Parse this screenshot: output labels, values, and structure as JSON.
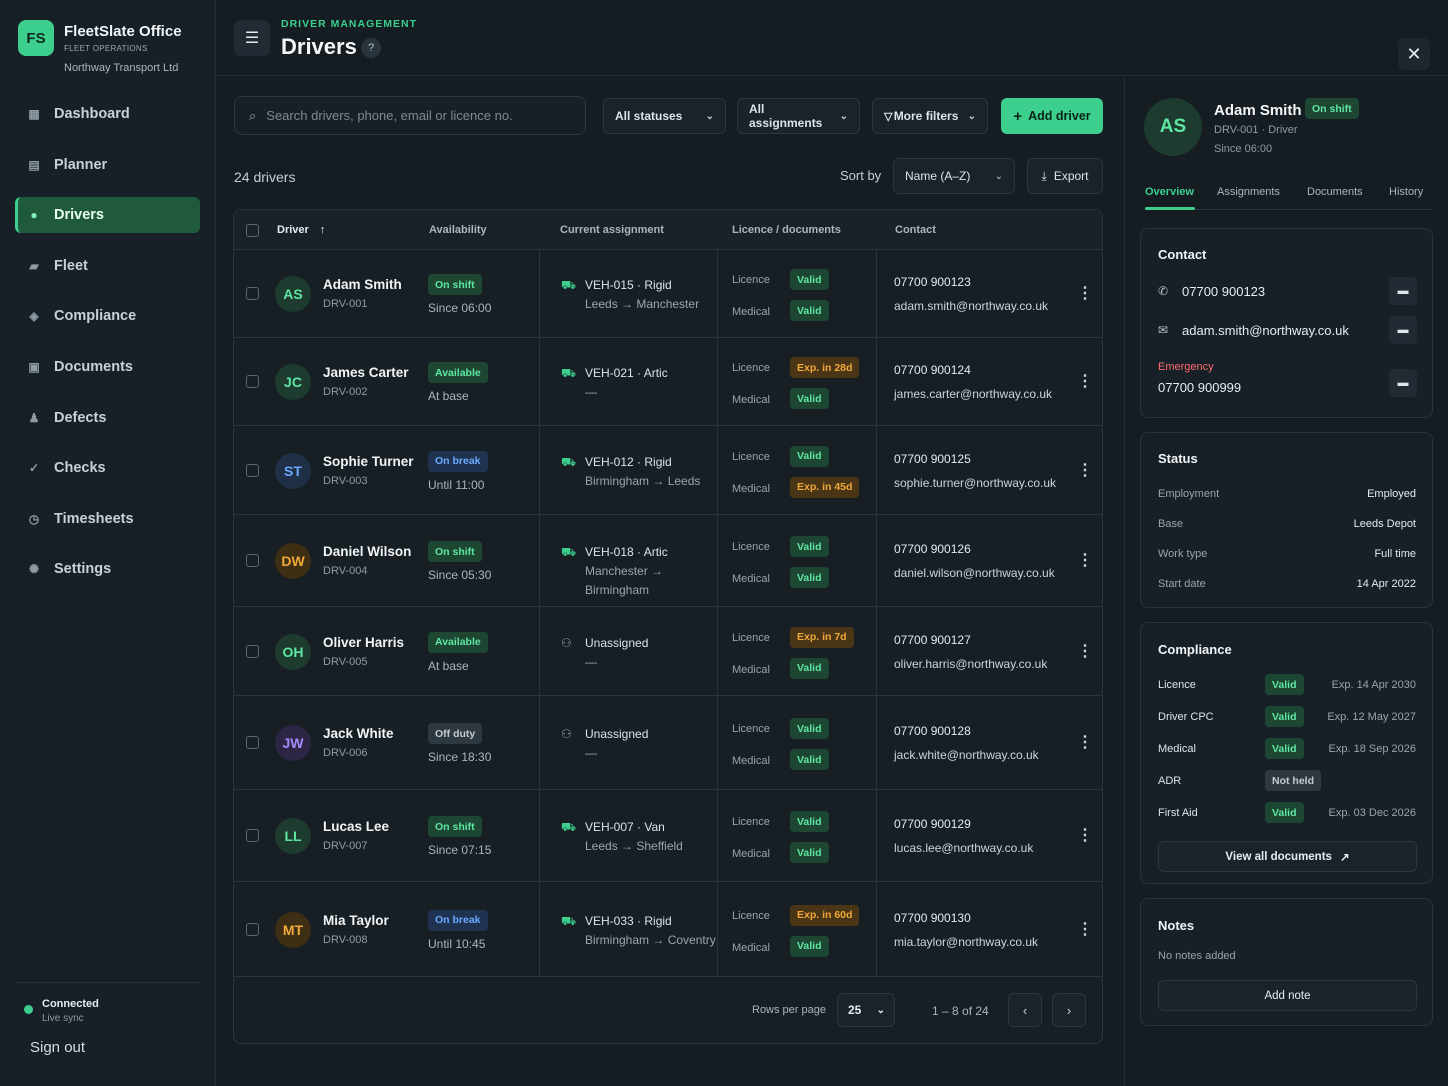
{
  "brand": {
    "logo": "FS",
    "name": "FleetSlate Office",
    "sub": "FLEET OPERATIONS",
    "org": "Northway Transport Ltd"
  },
  "nav": [
    {
      "label": "Dashboard",
      "icon": "grid-icon"
    },
    {
      "label": "Planner",
      "icon": "calendar-icon"
    },
    {
      "label": "Drivers",
      "icon": "user-icon",
      "active": true
    },
    {
      "label": "Fleet",
      "icon": "truck-icon"
    },
    {
      "label": "Compliance",
      "icon": "diamond-icon"
    },
    {
      "label": "Documents",
      "icon": "file-icon"
    },
    {
      "label": "Defects",
      "icon": "person-icon"
    },
    {
      "label": "Checks",
      "icon": "check-icon"
    },
    {
      "label": "Timesheets",
      "icon": "clock-icon"
    },
    {
      "label": "Settings",
      "icon": "gear-icon"
    }
  ],
  "status": {
    "connected": "Connected",
    "sync": "Live sync"
  },
  "signout": "Sign out",
  "header": {
    "eyebrow": "DRIVER MANAGEMENT",
    "title": "Drivers",
    "help": "?"
  },
  "toolbar": {
    "search_placeholder": "Search drivers, phone, email or licence no.",
    "statuses": "All statuses",
    "assignments": "All assignments",
    "more_filters": "More filters",
    "add_driver": "Add driver",
    "count": "24 drivers",
    "sort_label": "Sort by",
    "sort_value": "Name (A–Z)",
    "export": "Export"
  },
  "columns": {
    "driver": "Driver",
    "availability": "Availability",
    "assignment": "Current assignment",
    "docs": "Licence / documents",
    "contact": "Contact"
  },
  "doc_labels": {
    "licence": "Licence",
    "medical": "Medical"
  },
  "drivers": [
    {
      "initials": "AS",
      "name": "Adam Smith",
      "id": "DRV-001",
      "status": "On shift",
      "status_kind": "green",
      "since": "Since 06:00",
      "assigned": true,
      "vehicle": "VEH-015 · Rigid",
      "route": "Leeds → Manchester",
      "licence": "Valid",
      "licence_kind": "green",
      "medical": "Valid",
      "medical_kind": "green",
      "phone": "07700 900123",
      "email": "adam.smith@northway.co.uk",
      "avatar_bg": "#1d3b2e",
      "avatar_fg": "#5ee6a2"
    },
    {
      "initials": "JC",
      "name": "James Carter",
      "id": "DRV-002",
      "status": "Available",
      "status_kind": "green",
      "since": "At base",
      "assigned": true,
      "vehicle": "VEH-021 · Artic",
      "route": "—",
      "licence": "Exp. in 28d",
      "licence_kind": "amber",
      "medical": "Valid",
      "medical_kind": "green",
      "phone": "07700 900124",
      "email": "james.carter@northway.co.uk",
      "avatar_bg": "#1d3b2e",
      "avatar_fg": "#5ee6a2"
    },
    {
      "initials": "ST",
      "name": "Sophie Turner",
      "id": "DRV-003",
      "status": "On break",
      "status_kind": "blue",
      "since": "Until 11:00",
      "assigned": true,
      "vehicle": "VEH-012 · Rigid",
      "route": "Birmingham → Leeds",
      "licence": "Valid",
      "licence_kind": "green",
      "medical": "Exp. in 45d",
      "medical_kind": "amber",
      "phone": "07700 900125",
      "email": "sophie.turner@northway.co.uk",
      "avatar_bg": "#1f2f45",
      "avatar_fg": "#6aa9ff"
    },
    {
      "initials": "DW",
      "name": "Daniel Wilson",
      "id": "DRV-004",
      "status": "On shift",
      "status_kind": "green",
      "since": "Since 05:30",
      "assigned": true,
      "vehicle": "VEH-018 · Artic",
      "route": "Manchester → Birmingham",
      "licence": "Valid",
      "licence_kind": "green",
      "medical": "Valid",
      "medical_kind": "green",
      "phone": "07700 900126",
      "email": "daniel.wilson@northway.co.uk",
      "avatar_bg": "#3d2e14",
      "avatar_fg": "#f0a93a"
    },
    {
      "initials": "OH",
      "name": "Oliver Harris",
      "id": "DRV-005",
      "status": "Available",
      "status_kind": "green",
      "since": "At base",
      "assigned": false,
      "vehicle": "Unassigned",
      "route": "—",
      "licence": "Exp. in 7d",
      "licence_kind": "amber",
      "medical": "Valid",
      "medical_kind": "green",
      "phone": "07700 900127",
      "email": "oliver.harris@northway.co.uk",
      "avatar_bg": "#1d3b2e",
      "avatar_fg": "#5ee6a2"
    },
    {
      "initials": "JW",
      "name": "Jack White",
      "id": "DRV-006",
      "status": "Off duty",
      "status_kind": "grey",
      "since": "Since 18:30",
      "assigned": false,
      "vehicle": "Unassigned",
      "route": "—",
      "licence": "Valid",
      "licence_kind": "green",
      "medical": "Valid",
      "medical_kind": "green",
      "phone": "07700 900128",
      "email": "jack.white@northway.co.uk",
      "avatar_bg": "#2c2545",
      "avatar_fg": "#a78bfa"
    },
    {
      "initials": "LL",
      "name": "Lucas Lee",
      "id": "DRV-007",
      "status": "On shift",
      "status_kind": "green",
      "since": "Since 07:15",
      "assigned": true,
      "vehicle": "VEH-007 · Van",
      "route": "Leeds → Sheffield",
      "licence": "Valid",
      "licence_kind": "green",
      "medical": "Valid",
      "medical_kind": "green",
      "phone": "07700 900129",
      "email": "lucas.lee@northway.co.uk",
      "avatar_bg": "#1d3b2e",
      "avatar_fg": "#5ee6a2"
    },
    {
      "initials": "MT",
      "name": "Mia Taylor",
      "id": "DRV-008",
      "status": "On break",
      "status_kind": "blue",
      "since": "Until 10:45",
      "assigned": true,
      "vehicle": "VEH-033 · Rigid",
      "route": "Birmingham → Coventry",
      "licence": "Exp. in 60d",
      "licence_kind": "amber",
      "medical": "Valid",
      "medical_kind": "green",
      "phone": "07700 900130",
      "email": "mia.taylor@northway.co.uk",
      "avatar_bg": "#3d2e14",
      "avatar_fg": "#f0a93a"
    }
  ],
  "pagination": {
    "rows_label": "Rows per page",
    "rows": "25",
    "range": "1 – 8 of 24"
  },
  "detail": {
    "initials": "AS",
    "name": "Adam Smith",
    "status": "On shift",
    "id": "DRV-001",
    "role": "Driver",
    "since": "Since 06:00",
    "tabs": [
      "Overview",
      "Assignments",
      "Documents",
      "History"
    ],
    "contact": {
      "title": "Contact",
      "phone": "07700 900123",
      "email": "adam.smith@northway.co.uk",
      "emergency_label": "Emergency",
      "emergency": "07700 900999"
    },
    "status_card": {
      "title": "Status",
      "rows": [
        {
          "k": "Employment",
          "v": "Employed"
        },
        {
          "k": "Base",
          "v": "Leeds Depot"
        },
        {
          "k": "Work type",
          "v": "Full time"
        },
        {
          "k": "Start date",
          "v": "14 Apr 2022"
        }
      ]
    },
    "compliance": {
      "title": "Compliance",
      "rows": [
        {
          "k": "Licence",
          "badge": "Valid",
          "kind": "green",
          "exp": "Exp. 14 Apr 2030"
        },
        {
          "k": "Driver CPC",
          "badge": "Valid",
          "kind": "green",
          "exp": "Exp. 12 May 2027"
        },
        {
          "k": "Medical",
          "badge": "Valid",
          "kind": "green",
          "exp": "Exp. 18 Sep 2026"
        },
        {
          "k": "ADR",
          "badge": "Not held",
          "kind": "grey",
          "exp": ""
        },
        {
          "k": "First Aid",
          "badge": "Valid",
          "kind": "green",
          "exp": "Exp. 03 Dec 2026"
        }
      ],
      "view_all": "View all documents"
    },
    "notes": {
      "title": "Notes",
      "empty": "No notes added",
      "add": "Add note"
    }
  }
}
